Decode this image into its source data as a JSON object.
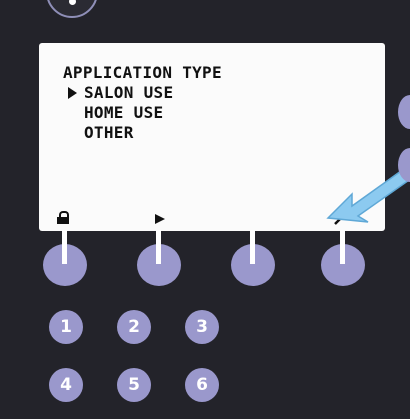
{
  "screen": {
    "title": "APPLICATION TYPE",
    "options": [
      "SALON USE",
      "HOME USE",
      "OTHER"
    ],
    "selected_option": "SALON USE"
  },
  "softkey_icons": [
    "lock-icon",
    "play-arrow-icon",
    "",
    "wrench-icon"
  ],
  "keypad": {
    "keys": [
      "1",
      "2",
      "3",
      "4",
      "5",
      "6"
    ]
  },
  "colors": {
    "panel": "#23232a",
    "button": "#9a98cc",
    "lcd": "#fbfbfb",
    "callout": "#8ccaf0"
  }
}
